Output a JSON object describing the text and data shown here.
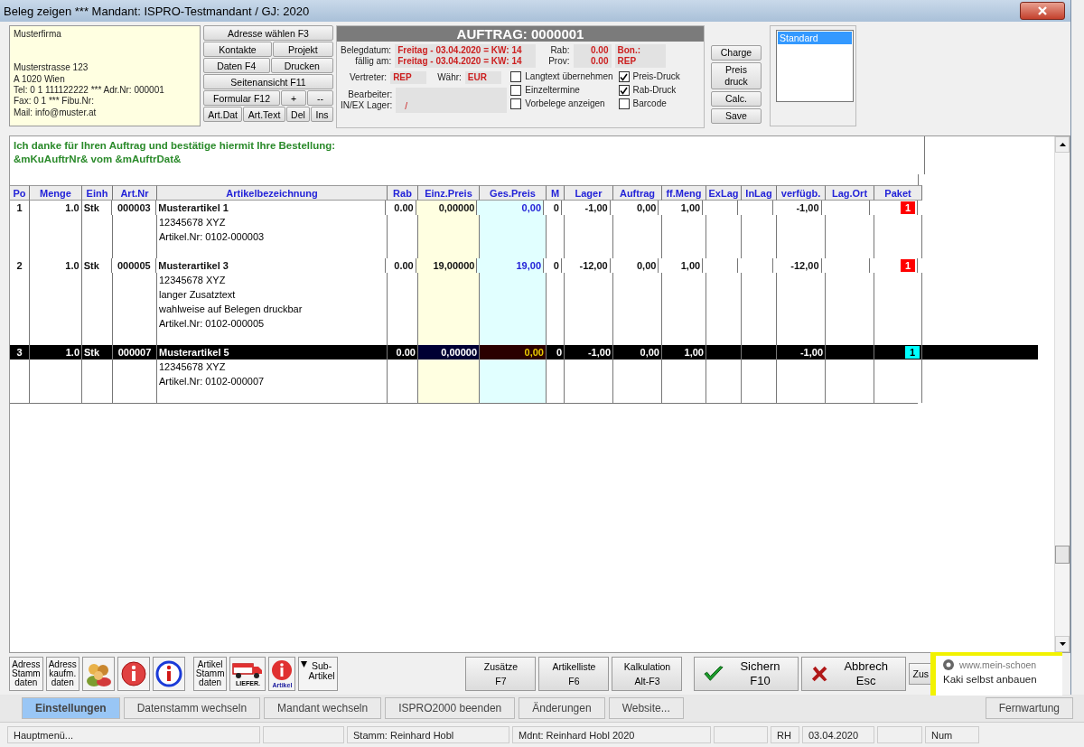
{
  "window": {
    "title": "Beleg zeigen *** Mandant: ISPRO-Testmandant / GJ: 2020"
  },
  "address": {
    "company": "Musterfirma",
    "lines": [
      "Musterstrasse 123",
      "A 1020 Wien",
      "Tel: 0 1 111122222 *** Adr.Nr: 000001",
      "Fax: 0 1 *** Fibu.Nr:",
      "Mail: info@muster.at"
    ]
  },
  "header_buttons": [
    [
      "Adresse wählen F3"
    ],
    [
      "Kontakte",
      "Projekt"
    ],
    [
      "Daten  F4",
      "Drucken"
    ],
    [
      "Seitenansicht  F11"
    ],
    [
      "Formular  F12",
      "+",
      "--"
    ],
    [
      "Art.Dat",
      "Art.Text",
      "Del",
      "Ins"
    ]
  ],
  "document": {
    "title": "AUFTRAG: 0000001",
    "belegdatum_label": "Belegdatum:",
    "belegdatum": "Freitag - 03.04.2020 = KW: 14",
    "faellig_label": "fällig am:",
    "faellig": "Freitag - 03.04.2020 = KW: 14",
    "rab_label": "Rab:",
    "rab": "0.00",
    "prov_label": "Prov:",
    "prov": "0.00",
    "bon_label": "Bon.:",
    "bon": "REP",
    "vertreter_label": "Vertreter:",
    "vertreter": "REP",
    "waehr_label": "Währ:",
    "waehr": "EUR",
    "bearbeiter_label": "Bearbeiter:",
    "lager_label": "IN/EX Lager:",
    "lager": "/"
  },
  "options": [
    {
      "label": "Langtext übernehmen",
      "checked": false
    },
    {
      "label": "Einzeltermine",
      "checked": false
    },
    {
      "label": "Vorbelege anzeigen",
      "checked": false
    },
    {
      "label": "Preis-Druck",
      "checked": true
    },
    {
      "label": "Rab-Druck",
      "checked": true
    },
    {
      "label": "Barcode",
      "checked": false
    }
  ],
  "side_buttons": [
    [
      "Charge"
    ],
    [
      "Preis",
      "druck"
    ],
    [
      "Calc."
    ],
    [
      "Save"
    ]
  ],
  "layouts": [
    {
      "label": "Standard",
      "selected": true
    }
  ],
  "intro": [
    "Ich danke für Ihren Auftrag und bestätige hiermit Ihre Bestellung:",
    "&mKuAuftrNr& vom &mAuftrDat&"
  ],
  "table": {
    "columns": [
      "Po",
      "Menge",
      "Einh",
      "Art.Nr",
      "Artikelbezeichnung",
      "Rab",
      "Einz.Preis",
      "Ges.Preis",
      "M",
      "Lager",
      "Auftrag",
      "ff.Meng",
      "ExLag",
      "InLag",
      "verfügb.",
      "Lag.Ort",
      "Paket"
    ],
    "rows": [
      {
        "po": "1",
        "menge": "1.0",
        "einh": "Stk",
        "art_nr": "000003",
        "description": [
          "Musterartikel 1",
          "12345678 XYZ",
          "Artikel.Nr: 0102-000003"
        ],
        "rab": "0.00",
        "einz_preis": "0,00000",
        "ges_preis": "0,00",
        "m": "0",
        "lager": "-1,00",
        "auftrag": "0,00",
        "off_menge": "1,00",
        "verfuegb": "-1,00",
        "paket": {
          "label": "1",
          "color": "#ff0000"
        },
        "selected": false
      },
      {
        "po": "2",
        "menge": "1.0",
        "einh": "Stk",
        "art_nr": "000005",
        "description": [
          "Musterartikel 3",
          "12345678 XYZ",
          "langer Zusatztext",
          "wahlweise auf Belegen druckbar",
          "Artikel.Nr: 0102-000005"
        ],
        "rab": "0.00",
        "einz_preis": "19,00000",
        "ges_preis": "19,00",
        "m": "0",
        "lager": "-12,00",
        "auftrag": "0,00",
        "off_menge": "1,00",
        "verfuegb": "-12,00",
        "paket": {
          "label": "1",
          "color": "#ff0000"
        },
        "selected": false
      },
      {
        "po": "3",
        "menge": "1.0",
        "einh": "Stk",
        "art_nr": "000007",
        "description": [
          "Musterartikel 5",
          "12345678 XYZ",
          "Artikel.Nr: 0102-000007"
        ],
        "rab": "0.00",
        "einz_preis": "0,00000",
        "ges_preis": "0,00",
        "m": "0",
        "lager": "-1,00",
        "auftrag": "0,00",
        "off_menge": "1,00",
        "verfuegb": "-1,00",
        "paket": {
          "label": "1",
          "color": "#00ffff"
        },
        "selected": true
      }
    ]
  },
  "toolbar": [
    {
      "kind": "text",
      "lines": [
        "Adress",
        "Stamm",
        "daten"
      ]
    },
    {
      "kind": "text",
      "lines": [
        "Adress",
        "kaufm.",
        "daten"
      ]
    },
    {
      "kind": "people"
    },
    {
      "kind": "info_red"
    },
    {
      "kind": "info_blue"
    },
    {
      "kind": "text",
      "lines": [
        "Artikel",
        "Stamm",
        "daten"
      ]
    },
    {
      "kind": "truck",
      "caption": "LIEFER."
    },
    {
      "kind": "info_article",
      "caption": "Artikel"
    },
    {
      "kind": "sub",
      "lines": [
        "Sub-",
        "Artikel"
      ]
    }
  ],
  "actions": [
    {
      "kind": "plain",
      "lines": [
        "Zusätze",
        "F7"
      ]
    },
    {
      "kind": "plain",
      "lines": [
        "Artikelliste",
        "F6"
      ]
    },
    {
      "kind": "plain",
      "lines": [
        "Kalkulation",
        "Alt-F3"
      ]
    },
    {
      "kind": "save",
      "lines": [
        "Sichern F10"
      ]
    },
    {
      "kind": "cancel",
      "lines": [
        "Abbrech Esc"
      ]
    },
    {
      "kind": "small",
      "lines": [
        "Zus"
      ]
    }
  ],
  "background_buttons": [
    "Einstellungen",
    "Datenstamm wechseln",
    "Mandant wechseln",
    "ISPRO2000 beenden",
    "Änderungen",
    "Website...",
    "Fernwartung"
  ],
  "notification": {
    "site": "www.mein-schoen",
    "text": "Kaki selbst anbauen"
  },
  "status_bar": [
    {
      "kind": "text",
      "text": "Hauptmenü..."
    },
    {
      "kind": "blank"
    },
    {
      "kind": "text",
      "text": "Stamm: Reinhard Hobl"
    },
    {
      "kind": "text",
      "text": "Mdnt: Reinhard Hobl 2020"
    },
    {
      "kind": "blank"
    },
    {
      "kind": "text",
      "text": "RH"
    },
    {
      "kind": "text",
      "text": "03.04.2020"
    },
    {
      "kind": "blank"
    },
    {
      "kind": "text",
      "text": "Num"
    }
  ]
}
